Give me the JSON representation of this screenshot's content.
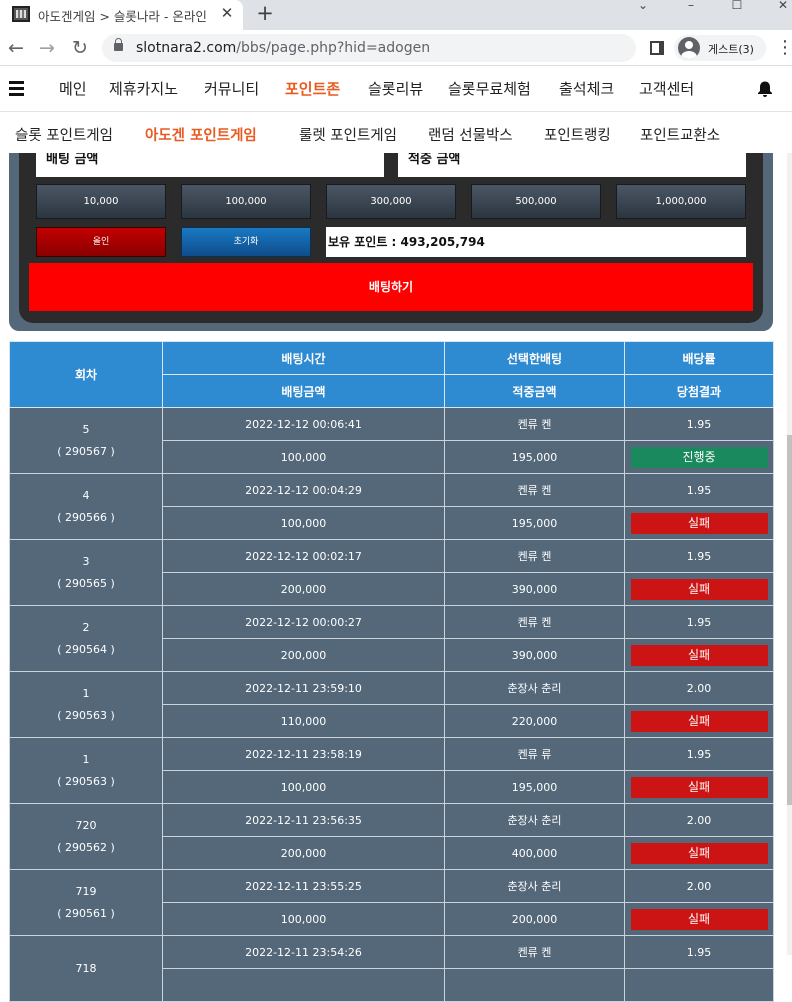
{
  "browser": {
    "tab_title": "아도겐게임 > 슬롯나라 - 온라인",
    "tab_close": "✕",
    "new_tab": "+",
    "url_host": "slotnara2.com",
    "url_path": "/bbs/page.php?hid=adogen",
    "profile_name": "게스트(3)",
    "menu": "⋮",
    "back": "←",
    "forward": "→",
    "reload": "↻"
  },
  "nav_primary": [
    "메인",
    "제휴카지노",
    "커뮤니티",
    "포인트존",
    "슬롯리뷰",
    "슬롯무료체험",
    "출석체크",
    "고객센터"
  ],
  "nav_primary_active": "포인트존",
  "nav_secondary": [
    "슬롯 포인트게임",
    "아도겐 포인트게임",
    "룰렛 포인트게임",
    "랜덤 선물박스",
    "포인트랭킹",
    "포인트교환소"
  ],
  "nav_secondary_active": "아도겐 포인트게임",
  "bet": {
    "bet_amount_label": "배팅 금액",
    "win_amount_label": "적중 금액",
    "amounts": [
      "10,000",
      "100,000",
      "300,000",
      "500,000",
      "1,000,000"
    ],
    "all_in_label": "올인",
    "reset_label": "초기화",
    "points_label": "보유 포인트 : 493,205,794",
    "submit_label": "배팅하기"
  },
  "history": {
    "headers": {
      "round": "회차",
      "bet_time": "배팅시간",
      "selected_bet": "선택한배팅",
      "odds": "배당률",
      "bet_amount": "배팅금액",
      "win_amount": "적중금액",
      "result": "당첨결과"
    },
    "rows": [
      {
        "round": "5",
        "id": "( 290567 )",
        "time": "2022-12-12 00:06:41",
        "pick": "켄류 켄",
        "odds": "1.95",
        "amount": "100,000",
        "win": "195,000",
        "result": "진행중",
        "status": "running"
      },
      {
        "round": "4",
        "id": "( 290566 )",
        "time": "2022-12-12 00:04:29",
        "pick": "켄류 켄",
        "odds": "1.95",
        "amount": "100,000",
        "win": "195,000",
        "result": "실패",
        "status": "fail"
      },
      {
        "round": "3",
        "id": "( 290565 )",
        "time": "2022-12-12 00:02:17",
        "pick": "켄류 켄",
        "odds": "1.95",
        "amount": "200,000",
        "win": "390,000",
        "result": "실패",
        "status": "fail"
      },
      {
        "round": "2",
        "id": "( 290564 )",
        "time": "2022-12-12 00:00:27",
        "pick": "켄류 켄",
        "odds": "1.95",
        "amount": "200,000",
        "win": "390,000",
        "result": "실패",
        "status": "fail"
      },
      {
        "round": "1",
        "id": "( 290563 )",
        "time": "2022-12-11 23:59:10",
        "pick": "춘장사 춘리",
        "odds": "2.00",
        "amount": "110,000",
        "win": "220,000",
        "result": "실패",
        "status": "fail"
      },
      {
        "round": "1",
        "id": "( 290563 )",
        "time": "2022-12-11 23:58:19",
        "pick": "켄류 류",
        "odds": "1.95",
        "amount": "100,000",
        "win": "195,000",
        "result": "실패",
        "status": "fail"
      },
      {
        "round": "720",
        "id": "( 290562 )",
        "time": "2022-12-11 23:56:35",
        "pick": "춘장사 춘리",
        "odds": "2.00",
        "amount": "200,000",
        "win": "400,000",
        "result": "실패",
        "status": "fail"
      },
      {
        "round": "719",
        "id": "( 290561 )",
        "time": "2022-12-11 23:55:25",
        "pick": "춘장사 춘리",
        "odds": "2.00",
        "amount": "100,000",
        "win": "200,000",
        "result": "실패",
        "status": "fail"
      },
      {
        "round": "718",
        "id": "",
        "time": "2022-12-11 23:54:26",
        "pick": "켄류 켄",
        "odds": "1.95",
        "amount": "",
        "win": "",
        "result": "",
        "status": ""
      }
    ]
  }
}
